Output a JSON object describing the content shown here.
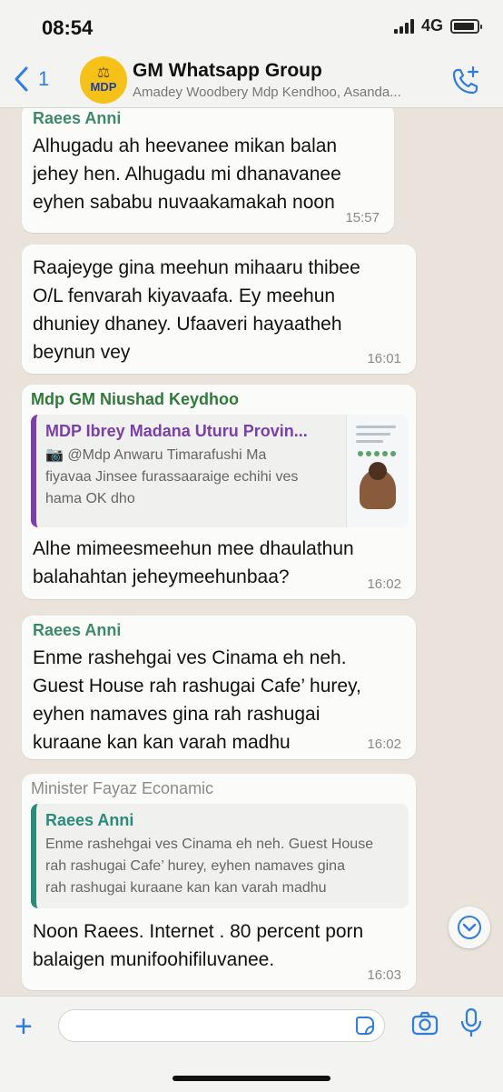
{
  "status_bar": {
    "time": "08:54",
    "network": "4G"
  },
  "header": {
    "back_count": "1",
    "avatar_text": "MDP",
    "title": "GM Whatsapp Group",
    "subtitle": "Amadey Woodbery Mdp Kendhoo, Asanda..."
  },
  "messages": [
    {
      "sender": "Raees Anni",
      "sender_color": "#3d8a6a",
      "lines": [
        "Alhugadu ah heevanee mikan balan",
        "jehey hen. Alhugadu mi dhanavanee",
        "eyhen sababu nuvaakamakah noon"
      ],
      "time": "15:57"
    },
    {
      "lines": [
        "Raajeyge gina meehun mihaaru thibee",
        "O/L fenvarah kiyavaafa. Ey meehun",
        "dhuniey dhaney. Ufaaveri hayaatheh",
        "beynun vey"
      ],
      "time": "16:01"
    },
    {
      "sender": "Mdp GM Niushad Keydhoo",
      "sender_color": "#2f7a3a",
      "quote": {
        "title": "MDP Ibrey Madana Uturu Provin...",
        "lines": [
          "@Mdp Anwaru Timarafushi Ma",
          "fiyavaa Jinsee furassaaraige echihi ves",
          "hama OK dho"
        ]
      },
      "lines": [
        "Alhe mimeesmeehun mee dhaulathun",
        "balahahtan jeheymeehunbaa?"
      ],
      "time": "16:02"
    },
    {
      "sender": "Raees Anni",
      "sender_color": "#3d8a6a",
      "lines": [
        "Enme rashehgai ves Cinama eh neh.",
        "Guest House rah rashugai Cafe’ hurey,",
        "eyhen namaves gina rah rashugai",
        "kuraane kan kan varah madhu"
      ],
      "time": "16:02"
    },
    {
      "sender": "Minister Fayaz Econamic",
      "sender_color": "#8a8a8a",
      "quote": {
        "title": "Raees Anni",
        "lines": [
          "Enme rashehgai ves Cinama eh neh. Guest House",
          "rah rashugai Cafe’ hurey, eyhen namaves gina",
          "rah rashugai kuraane kan kan varah madhu"
        ]
      },
      "lines": [
        "Noon Raees. Internet . 80 percent porn",
        "balaigen munifoohifiluvanee."
      ],
      "time": "16:03"
    }
  ],
  "colors": {
    "accent": "#2f7de1"
  }
}
